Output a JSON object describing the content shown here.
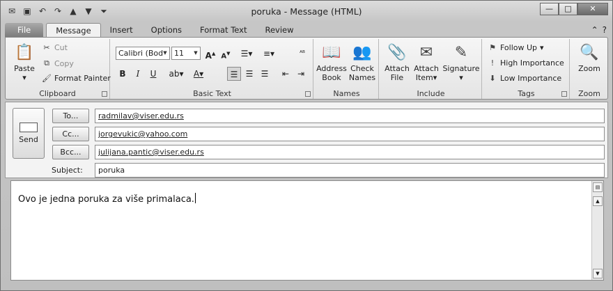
{
  "window": {
    "title": "poruka  -  Message (HTML)",
    "controls": {
      "minimize": "—",
      "maximize": "□",
      "close": "✕"
    }
  },
  "qat_icons": [
    "outlook-icon",
    "save-icon",
    "undo-icon",
    "redo-icon",
    "up-icon",
    "down-icon",
    "customize-icon"
  ],
  "tabs": [
    "File",
    "Message",
    "Insert",
    "Options",
    "Format Text",
    "Review"
  ],
  "active_tab": "Message",
  "ribbon": {
    "clipboard": {
      "label": "Clipboard",
      "paste": "Paste",
      "cut": "Cut",
      "copy": "Copy",
      "format_painter": "Format Painter"
    },
    "basic_text": {
      "label": "Basic Text",
      "font": "Calibri (Body)",
      "size": "11"
    },
    "names": {
      "label": "Names",
      "address_book_1": "Address",
      "address_book_2": "Book",
      "check_names_1": "Check",
      "check_names_2": "Names"
    },
    "include": {
      "label": "Include",
      "attach_file_1": "Attach",
      "attach_file_2": "File",
      "attach_item_1": "Attach",
      "attach_item_2": "Item",
      "signature": "Signature"
    },
    "tags": {
      "label": "Tags",
      "follow_up": "Follow Up",
      "high": "High Importance",
      "low": "Low Importance"
    },
    "zoom": {
      "label": "Zoom",
      "zoom": "Zoom"
    }
  },
  "compose": {
    "send": "Send",
    "to_button": "To...",
    "cc_button": "Cc...",
    "bcc_button": "Bcc...",
    "subject_label": "Subject:",
    "to": "radmilav@viser.edu.rs",
    "cc": "jorgevukic@yahoo.com",
    "bcc": "julijana.pantic@viser.edu.rs",
    "subject": "poruka",
    "body": "Ovo je jedna poruka za više primalaca."
  }
}
